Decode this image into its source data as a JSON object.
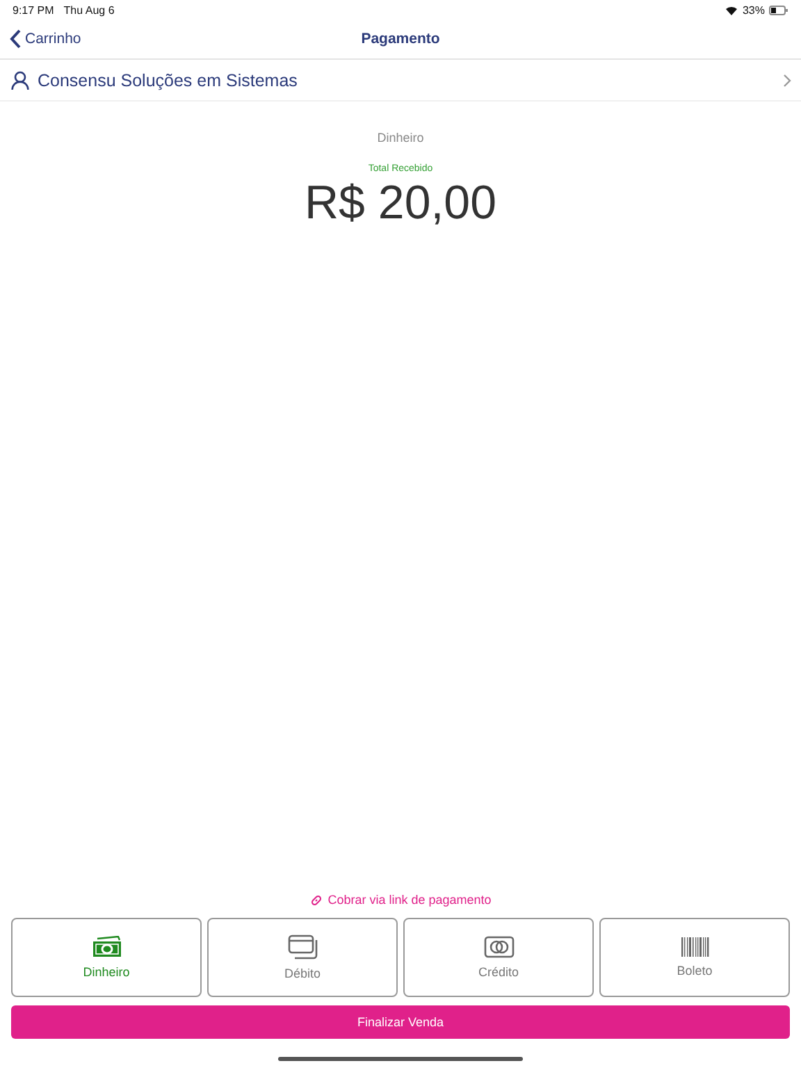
{
  "status_bar": {
    "time": "9:17 PM",
    "date": "Thu Aug 6",
    "battery": "33%"
  },
  "nav": {
    "back": "Carrinho",
    "title": "Pagamento"
  },
  "customer": {
    "name": "Consensu Soluções em Sistemas"
  },
  "payment": {
    "method": "Dinheiro",
    "caption": "Total Recebido",
    "amount": "R$ 20,00"
  },
  "payment_link": "Cobrar via link de pagamento",
  "methods": [
    {
      "kind": "cash",
      "label": "Dinheiro",
      "selected": true
    },
    {
      "kind": "debit",
      "label": "Débito",
      "selected": false
    },
    {
      "kind": "credit",
      "label": "Crédito",
      "selected": false
    },
    {
      "kind": "boleto",
      "label": "Boleto",
      "selected": false
    }
  ],
  "finish_button": "Finalizar Venda"
}
